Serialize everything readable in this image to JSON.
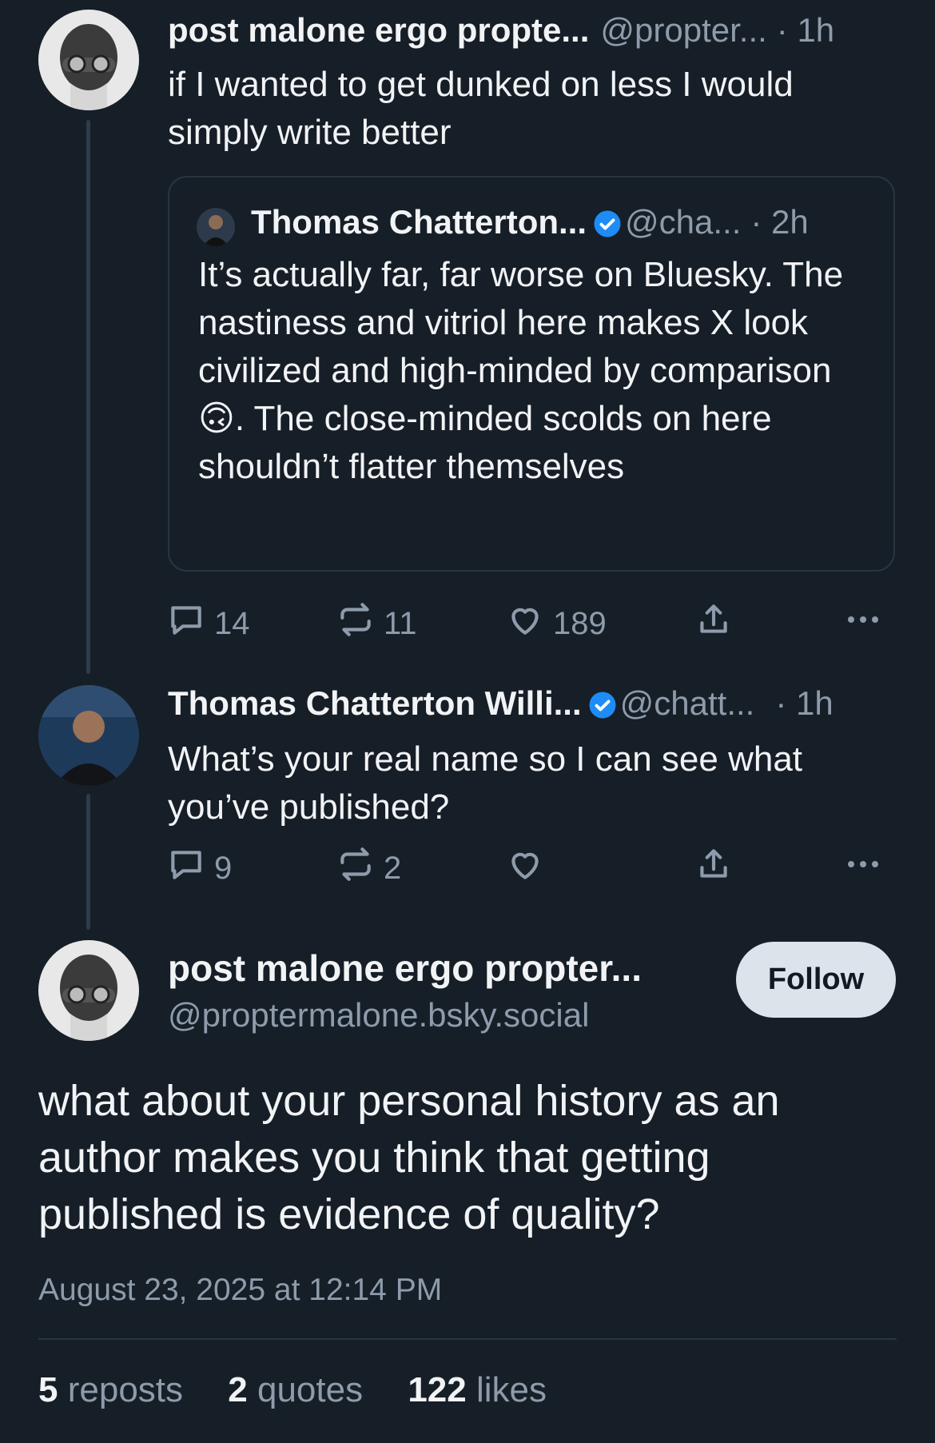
{
  "parent_post": {
    "display_name": "post malone ergo propte...",
    "handle": "@propter...",
    "time": "· 1h",
    "text": "if I wanted to get dunked on less I would simply write better",
    "quote": {
      "display_name": "Thomas Chatterton...",
      "handle": "@cha...",
      "time": "· 2h",
      "text": "It’s actually far, far worse on Bluesky. The nastiness and vitriol here makes X look civilized and high-minded by comparison 🙃. The close-minded scolds on here shouldn’t flatter themselves",
      "verified": true
    },
    "actions": {
      "replies": "14",
      "reposts": "11",
      "likes": "189"
    }
  },
  "reply_post": {
    "display_name": "Thomas Chatterton Willi...",
    "handle": "@chatt...",
    "time": "· 1h",
    "text": "What’s your real name so I can see what you’ve published?",
    "verified": true,
    "actions": {
      "replies": "9",
      "reposts": "2",
      "likes": ""
    }
  },
  "focused_post": {
    "display_name": "post malone ergo propter...",
    "handle": "@proptermalone.bsky.social",
    "follow_label": "Follow",
    "text": "what about your personal history as an author makes you think that getting published is evidence of quality?",
    "timestamp": "August 23, 2025 at 12:14 PM",
    "stats": {
      "reposts_count": "5",
      "reposts_label": "reposts",
      "quotes_count": "2",
      "quotes_label": "quotes",
      "likes_count": "122",
      "likes_label": "likes"
    }
  },
  "colors": {
    "background": "#161e27",
    "muted": "#8d9bab",
    "verified": "#1d8cf6"
  },
  "icons": [
    "reply-icon",
    "repost-icon",
    "like-icon",
    "share-icon",
    "more-icon",
    "verified-icon"
  ]
}
